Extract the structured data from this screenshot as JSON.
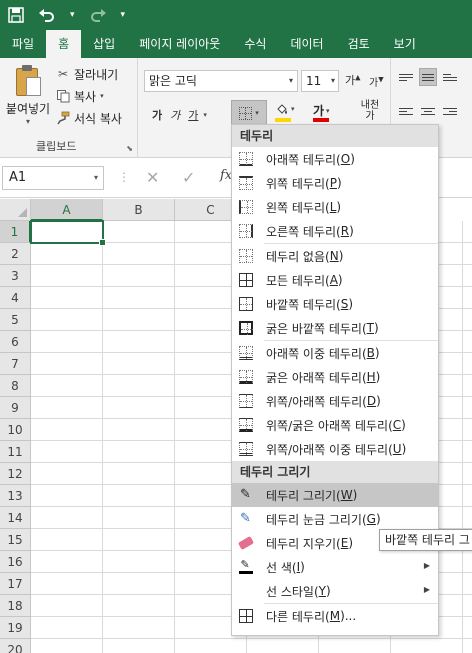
{
  "colors": {
    "accent": "#217346",
    "fill_bar": "#ffd700",
    "font_color_bar": "#e00000"
  },
  "titlebar": {
    "save_icon": "save-icon",
    "undo_icon": "undo-icon",
    "redo_icon": "redo-icon",
    "customize_icon": "customize-qat-icon"
  },
  "ribbon_tabs": [
    "파일",
    "홈",
    "삽입",
    "페이지 레이아웃",
    "수식",
    "데이터",
    "검토",
    "보기"
  ],
  "clipboard": {
    "paste_label": "붙여넣기",
    "cut_label": "잘라내기",
    "copy_label": "복사",
    "format_painter_label": "서식 복사",
    "group_label": "클립보드"
  },
  "font": {
    "font_name": "맑은 고딕",
    "font_size": "11",
    "grow_label": "가",
    "shrink_label": "가",
    "bold_label": "가",
    "italic_label": "가",
    "underline_label": "가",
    "font_color_label": "가",
    "phonetic_label_1": "내천",
    "phonetic_label_2": "가"
  },
  "formula_bar": {
    "name_box": "A1",
    "cancel_glyph": "✕",
    "enter_glyph": "✓",
    "fx_label": "fx"
  },
  "grid": {
    "columns": [
      "A",
      "B",
      "C"
    ],
    "rows": [
      "1",
      "2",
      "3",
      "4",
      "5",
      "6",
      "7",
      "8",
      "9",
      "10",
      "11",
      "12",
      "13",
      "14",
      "15",
      "16",
      "17",
      "18",
      "19",
      "20"
    ]
  },
  "border_menu": {
    "section1_title": "테두리",
    "section1": [
      {
        "text": "아래쪽 테두리(",
        "key": "O",
        "tail": ")",
        "icon": "bottom-border-icon"
      },
      {
        "text": "위쪽 테두리(",
        "key": "P",
        "tail": ")",
        "icon": "top-border-icon"
      },
      {
        "text": "왼쪽 테두리(",
        "key": "L",
        "tail": ")",
        "icon": "left-border-icon"
      },
      {
        "text": "오른쪽 테두리(",
        "key": "R",
        "tail": ")",
        "icon": "right-border-icon"
      },
      {
        "text": "테두리 없음(",
        "key": "N",
        "tail": ")",
        "icon": "no-border-icon"
      },
      {
        "text": "모든 테두리(",
        "key": "A",
        "tail": ")",
        "icon": "all-borders-icon"
      },
      {
        "text": "바깥쪽 테두리(",
        "key": "S",
        "tail": ")",
        "icon": "outside-borders-icon"
      },
      {
        "text": "굵은 바깥쪽 테두리(",
        "key": "T",
        "tail": ")",
        "icon": "thick-outside-borders-icon"
      },
      {
        "text": "아래쪽 이중 테두리(",
        "key": "B",
        "tail": ")",
        "icon": "bottom-double-border-icon"
      },
      {
        "text": "굵은 아래쪽 테두리(",
        "key": "H",
        "tail": ")",
        "icon": "thick-bottom-border-icon"
      },
      {
        "text": "위쪽/아래쪽 테두리(",
        "key": "D",
        "tail": ")",
        "icon": "top-bottom-border-icon"
      },
      {
        "text": "위쪽/굵은 아래쪽 테두리(",
        "key": "C",
        "tail": ")",
        "icon": "top-thick-bottom-border-icon"
      },
      {
        "text": "위쪽/아래쪽 이중 테두리(",
        "key": "U",
        "tail": ")",
        "icon": "top-double-bottom-border-icon"
      }
    ],
    "section2_title": "테두리 그리기",
    "section2": [
      {
        "text": "테두리 그리기(",
        "key": "W",
        "tail": ")",
        "icon": "draw-border-icon"
      },
      {
        "text": "테두리 눈금 그리기(",
        "key": "G",
        "tail": ")",
        "icon": "draw-border-grid-icon"
      },
      {
        "text": "테두리 지우기(",
        "key": "E",
        "tail": ")",
        "icon": "erase-border-icon"
      },
      {
        "text": "선 색(",
        "key": "I",
        "tail": ")",
        "icon": "line-color-icon"
      },
      {
        "text": "선 스타일(",
        "key": "Y",
        "tail": ")",
        "icon": "line-style-icon"
      },
      {
        "text": "다른 테두리(",
        "key": "M",
        "tail": ")...",
        "icon": "more-borders-icon"
      }
    ]
  },
  "tooltip": {
    "text": "바깥쪽 테두리 그"
  }
}
